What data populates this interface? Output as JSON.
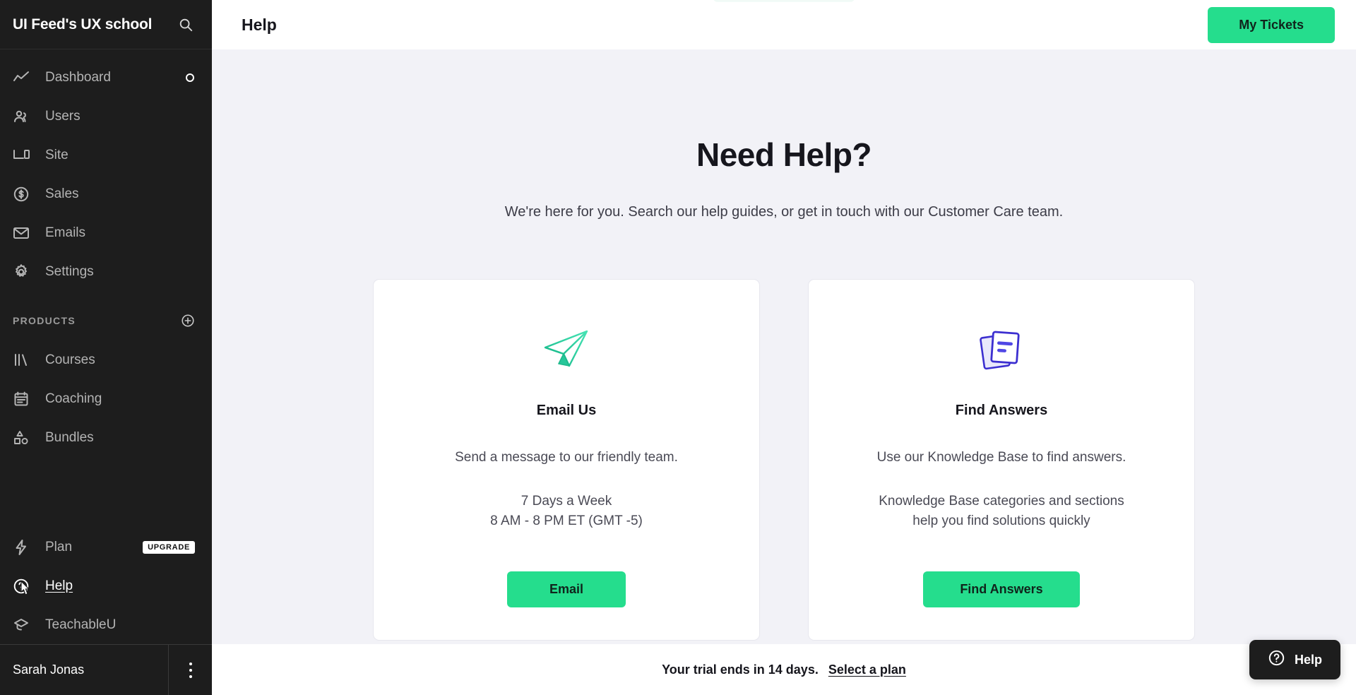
{
  "sidebar": {
    "brand": "UI Feed's UX school",
    "search_icon": "search-icon",
    "nav": [
      {
        "label": "Dashboard",
        "icon": "activity-chart-icon",
        "trailing": "circle-indicator"
      },
      {
        "label": "Users",
        "icon": "users-icon"
      },
      {
        "label": "Site",
        "icon": "devices-icon"
      },
      {
        "label": "Sales",
        "icon": "dollar-circle-icon"
      },
      {
        "label": "Emails",
        "icon": "envelope-icon"
      },
      {
        "label": "Settings",
        "icon": "gear-icon"
      }
    ],
    "products_section": {
      "label": "PRODUCTS",
      "add_icon": "plus-circle-icon",
      "items": [
        {
          "label": "Courses",
          "icon": "books-icon"
        },
        {
          "label": "Coaching",
          "icon": "clipboard-icon"
        },
        {
          "label": "Bundles",
          "icon": "shapes-icon"
        }
      ]
    },
    "bottom": [
      {
        "label": "Plan",
        "icon": "bolt-icon",
        "badge": "UPGRADE"
      },
      {
        "label": "Help",
        "icon": "question-circle-icon",
        "active": true
      },
      {
        "label": "TeachableU",
        "icon": "graduation-cap-icon"
      }
    ],
    "footer": {
      "user_name": "Sarah Jonas",
      "menu_icon": "kebab-menu-icon"
    }
  },
  "topbar": {
    "title": "Help",
    "my_tickets_label": "My Tickets"
  },
  "hero": {
    "title": "Need Help?",
    "subtitle": "We're here for you. Search our help guides, or get in touch with our Customer Care team."
  },
  "cards": [
    {
      "icon": "paper-plane-icon",
      "title": "Email Us",
      "description": "Send a message to our friendly team.",
      "hours_line1": "7 Days a Week",
      "hours_line2": "8 AM - 8 PM ET (GMT -5)",
      "button_label": "Email"
    },
    {
      "icon": "documents-icon",
      "title": "Find Answers",
      "description": "Use our Knowledge Base to find answers.",
      "hours_line1": "Knowledge Base categories and sections",
      "hours_line2": "help you find solutions quickly",
      "button_label": "Find Answers"
    }
  ],
  "trial_bar": {
    "message": "Your trial ends in 14 days.",
    "link_label": "Select a plan"
  },
  "help_widget": {
    "icon": "question-circle-icon",
    "label": "Help"
  },
  "colors": {
    "accent_green": "#25dd8d",
    "sidebar_bg": "#1d1d1d",
    "content_bg": "#f2f2f7",
    "card_bg": "#ffffff",
    "text_dark": "#16161d",
    "icon_plane_green": "#2ecc9b",
    "icon_docs_purple": "#4a3fd6"
  }
}
